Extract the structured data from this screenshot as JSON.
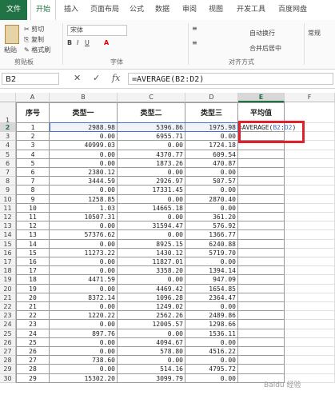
{
  "tabs": [
    "文件",
    "开始",
    "插入",
    "页面布局",
    "公式",
    "数据",
    "审阅",
    "视图",
    "开发工具",
    "百度网盘"
  ],
  "ribbon": {
    "paste": "粘贴",
    "cut": "剪切",
    "copy": "复制",
    "format_painter": "格式刷",
    "font_name": "宋体",
    "wrap": "自动换行",
    "merge": "合并后居中",
    "number_format": "常规",
    "groups": [
      "剪贴板",
      "字体",
      "对齐方式"
    ]
  },
  "formula_bar": {
    "name_box": "B2",
    "formula": "=AVERAGE(B2:D2)"
  },
  "columns": [
    "A",
    "B",
    "C",
    "D",
    "E",
    "F"
  ],
  "headers": [
    "序号",
    "类型一",
    "类型二",
    "类型三",
    "平均值"
  ],
  "rows": [
    [
      "1",
      "2988.98",
      "5396.86",
      "1975.98"
    ],
    [
      "2",
      "0.00",
      "6955.71",
      "0.00"
    ],
    [
      "3",
      "40999.03",
      "0.00",
      "1724.18"
    ],
    [
      "4",
      "0.00",
      "4370.77",
      "609.54"
    ],
    [
      "5",
      "0.00",
      "1873.26",
      "470.87"
    ],
    [
      "6",
      "2380.12",
      "0.00",
      "0.00"
    ],
    [
      "7",
      "3444.59",
      "2926.97",
      "507.57"
    ],
    [
      "8",
      "0.00",
      "17331.45",
      "0.00"
    ],
    [
      "9",
      "1258.85",
      "0.00",
      "2870.40"
    ],
    [
      "10",
      "1.03",
      "14665.18",
      "0.00"
    ],
    [
      "11",
      "10507.31",
      "0.00",
      "361.20"
    ],
    [
      "12",
      "0.00",
      "31594.47",
      "576.92"
    ],
    [
      "13",
      "57376.62",
      "0.00",
      "1366.77"
    ],
    [
      "14",
      "0.00",
      "8925.15",
      "6240.88"
    ],
    [
      "15",
      "11273.22",
      "1430.12",
      "5719.70"
    ],
    [
      "16",
      "0.00",
      "11827.01",
      "0.00"
    ],
    [
      "17",
      "0.00",
      "3358.20",
      "1394.14"
    ],
    [
      "18",
      "4471.59",
      "0.00",
      "947.09"
    ],
    [
      "19",
      "0.00",
      "4469.42",
      "1654.85"
    ],
    [
      "20",
      "8372.14",
      "1096.28",
      "2364.47"
    ],
    [
      "21",
      "0.00",
      "1249.02",
      "0.00"
    ],
    [
      "22",
      "1220.22",
      "2562.26",
      "2489.86"
    ],
    [
      "23",
      "0.00",
      "12005.57",
      "1298.66"
    ],
    [
      "24",
      "897.76",
      "0.00",
      "1536.11"
    ],
    [
      "25",
      "0.00",
      "4094.67",
      "0.00"
    ],
    [
      "26",
      "0.00",
      "578.80",
      "4516.22"
    ],
    [
      "27",
      "738.60",
      "0.00",
      "0.00"
    ],
    [
      "28",
      "0.00",
      "514.16",
      "4795.72"
    ],
    [
      "29",
      "15302.20",
      "3099.79",
      "0.00"
    ]
  ],
  "editing_cell": {
    "prefix": "=AVERAGE(",
    "ref1": "B2",
    "colon": ":",
    "ref2": "D2",
    "suffix": ")"
  },
  "watermark": "Baidu 经验"
}
